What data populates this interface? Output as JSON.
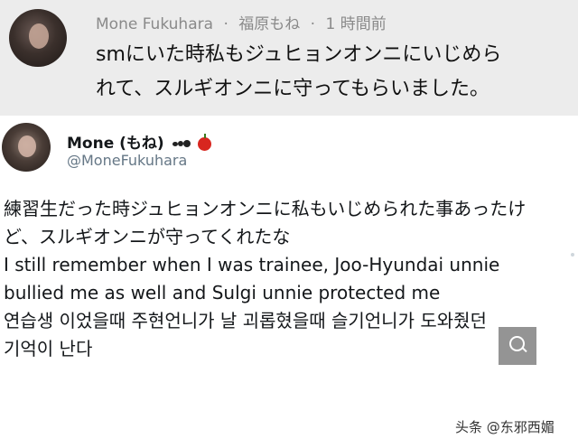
{
  "reply": {
    "author": "Mone Fukuhara",
    "separator": "·",
    "jp_name": "福原もね",
    "time": "1 時間前",
    "text_lines": [
      "smにいた時私もジュヒョンオンニにいじめら",
      "れて、スルギオンニに守ってもらいました。"
    ]
  },
  "tweet": {
    "display_name": "Mone (もね)",
    "emojis": [
      "ant-emoji",
      "apple-emoji"
    ],
    "handle": "@MoneFukuhara",
    "lines": [
      "練習生だった時ジュヒョンオンニに私もいじめられた事あったけ",
      "ど、スルギオンニが守ってくれたな",
      "I still remember when I was trainee, Joo-Hyundai unnie",
      "bullied me as well and Sulgi unnie protected me",
      "연습생 이었을때 주현언니가 날 괴롭혔을때 슬기언니가 도와줬던",
      "기억이 난다"
    ]
  },
  "watermark": "头条 @东邪西媚",
  "colors": {
    "top_bg": "#ececec",
    "handle_gray": "#657786",
    "meta_gray": "#8a8a8a"
  }
}
